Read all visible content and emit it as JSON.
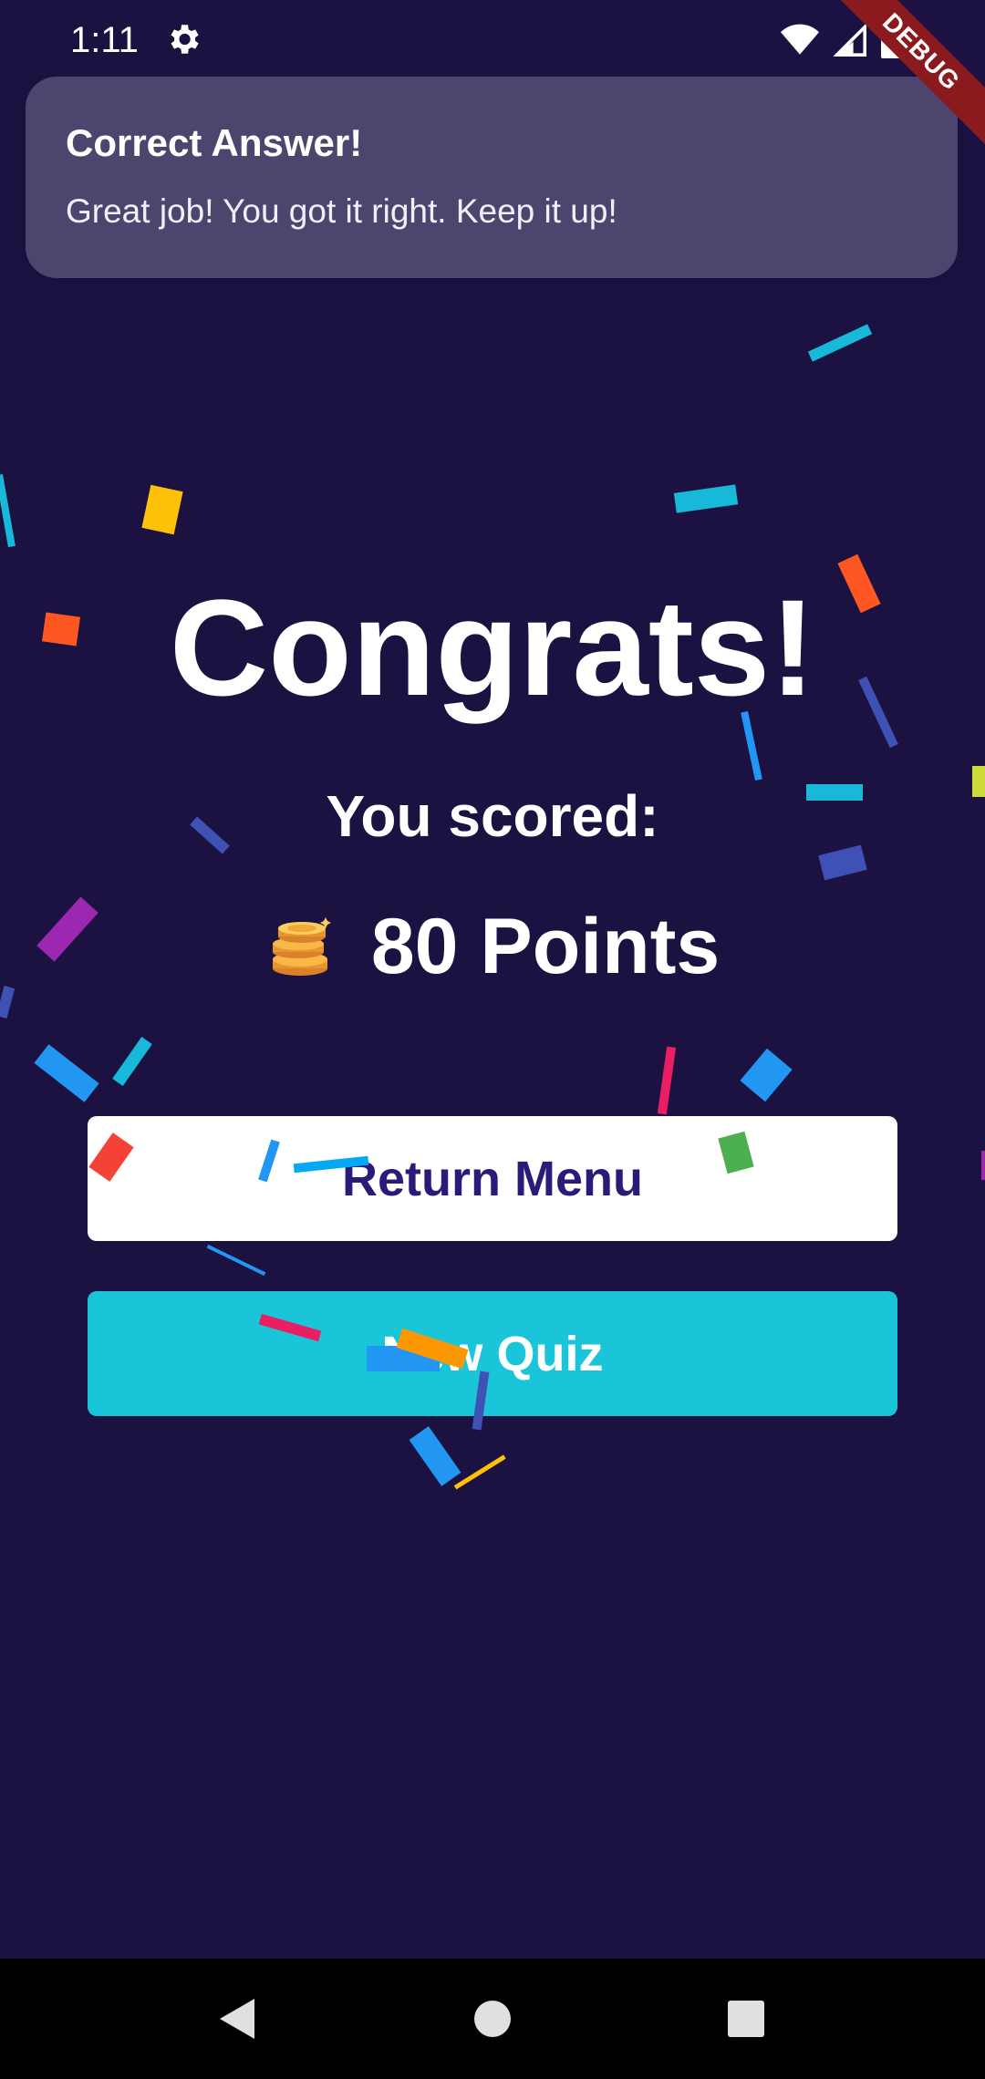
{
  "status_bar": {
    "time": "1:11",
    "icons": [
      "gear-icon",
      "wifi-icon",
      "signal-icon",
      "battery-icon"
    ],
    "debug_banner": "DEBUG"
  },
  "toast": {
    "title": "Correct Answer!",
    "message": "Great job! You got it right. Keep it up!"
  },
  "main": {
    "title": "Congrats!",
    "score_label": "You scored:",
    "points_icon": "coins-icon",
    "points_text": "80 Points"
  },
  "buttons": {
    "return_menu": "Return Menu",
    "new_quiz": "New Quiz"
  },
  "nav_bar": {
    "icons": [
      "back-icon",
      "home-icon",
      "recents-icon"
    ]
  },
  "colors": {
    "background": "#1c1242",
    "accent_cyan": "#1ac5d9",
    "button_text_purple": "#2a1b79",
    "white": "#ffffff"
  }
}
